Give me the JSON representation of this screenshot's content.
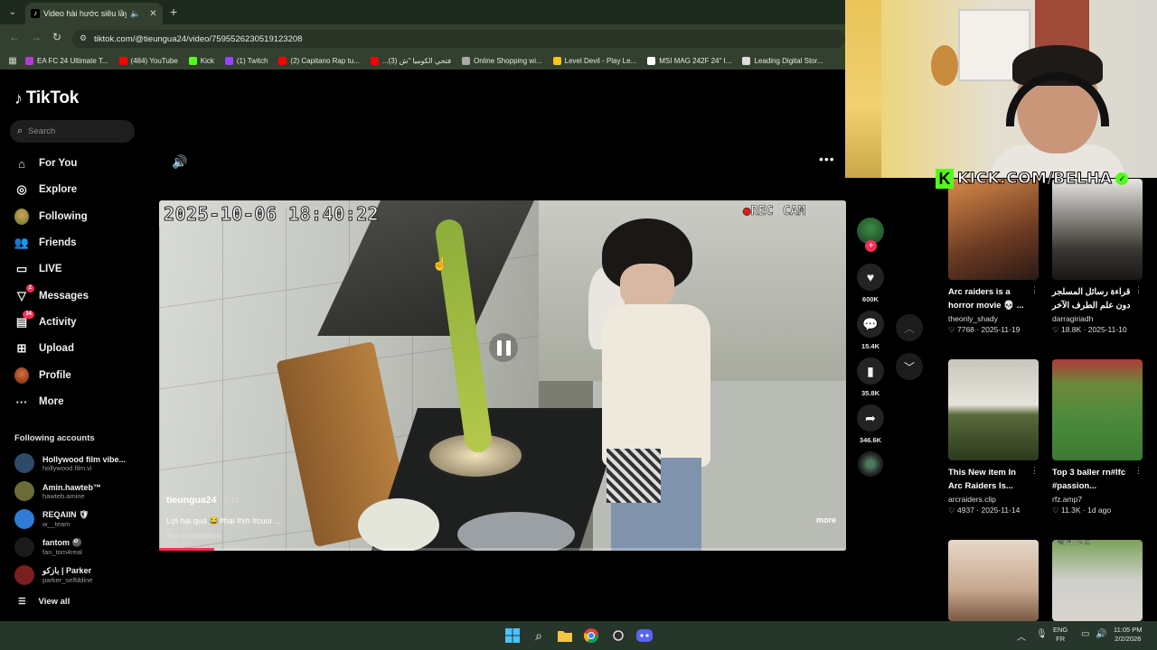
{
  "browser": {
    "tab_title": "Video hài hước siêu lầy lội",
    "url": "tiktok.com/@tieungua24/video/7595526230519123208",
    "bookmarks": [
      {
        "label": "EA FC 24 Ultimate T...",
        "color": "#b23bd6"
      },
      {
        "label": "(484) YouTube",
        "color": "#ff0000"
      },
      {
        "label": "Kick",
        "color": "#53fc18"
      },
      {
        "label": "(1) Twitch",
        "color": "#9146ff"
      },
      {
        "label": "(2) Capitano Rap tu...",
        "color": "#ff0000"
      },
      {
        "label": "...فتحي الكوميا \"ش (3)",
        "color": "#ff0000"
      },
      {
        "label": "Online Shopping wi...",
        "color": "#aaaaaa"
      },
      {
        "label": "Level Devil - Play Le...",
        "color": "#f5c518"
      },
      {
        "label": "MSI MAG 242F 24\" I...",
        "color": "#ffffff"
      },
      {
        "label": "Leading Digital Stor...",
        "color": "#dddddd"
      }
    ]
  },
  "sidebar": {
    "logo_text": "TikTok",
    "search_placeholder": "Search",
    "nav": [
      {
        "label": "For You",
        "icon": "home-icon",
        "glyph": "⌂"
      },
      {
        "label": "Explore",
        "icon": "compass-icon",
        "glyph": "◎"
      },
      {
        "label": "Following",
        "icon": "following-avatar-icon",
        "glyph": ""
      },
      {
        "label": "Friends",
        "icon": "friends-icon",
        "glyph": "👥"
      },
      {
        "label": "LIVE",
        "icon": "live-icon",
        "glyph": "▭"
      },
      {
        "label": "Messages",
        "icon": "send-icon",
        "glyph": "▽",
        "badge": "2"
      },
      {
        "label": "Activity",
        "icon": "inbox-icon",
        "glyph": "▤",
        "badge": "34"
      },
      {
        "label": "Upload",
        "icon": "upload-icon",
        "glyph": "⊞"
      },
      {
        "label": "Profile",
        "icon": "profile-avatar-icon",
        "glyph": ""
      },
      {
        "label": "More",
        "icon": "more-dots-icon",
        "glyph": "···"
      }
    ],
    "following_title": "Following accounts",
    "accounts": [
      {
        "name": "Hollywood film vibe...",
        "handle": "hollywood.film.vi",
        "color": "#2e4a6b"
      },
      {
        "name": "Amin.hawteb™",
        "handle": "hawteb.amine",
        "color": "#6b6b3a"
      },
      {
        "name": "REQAIIN 🛡",
        "handle": "w__team",
        "color": "#2f7bd6"
      },
      {
        "name": "fantom 🎱",
        "handle": "fan_tom4real",
        "color": "#1a1a1a"
      },
      {
        "name": "بازكو | Parker",
        "handle": "parker_selfddine",
        "color": "#7a1e1e"
      }
    ],
    "view_all": "View all"
  },
  "video": {
    "timestamp": "2025-10-06 18:40:22",
    "rec": "REC",
    "cam": "CAM",
    "author": "tieungua24",
    "post_time": "· 1-15",
    "caption": "Lợi hại quá 😂#hai #xh #cuoi ...",
    "translate": "See translation",
    "more": "more",
    "progress": 0.08
  },
  "actions": {
    "likes": "600K",
    "comments": "15.4K",
    "saves": "35.8K",
    "shares": "346.6K"
  },
  "overlay": {
    "kick_text": "KICK.COM/BELHA"
  },
  "related": [
    {
      "title": "Arc raiders is a horror movie 💀 ...",
      "user": "theonly_shady",
      "likes": "7768",
      "date": "2025-11-19",
      "bg": "linear-gradient(160deg,#d88a4a,#6b3a22 60%,#2a1a14)"
    },
    {
      "title": "قراءة رسائل المسلجر دون علم الطرف الآخر",
      "user": "darragiriadh",
      "likes": "18.8K",
      "date": "2025-11-10",
      "bg": "linear-gradient(180deg,#e8e6e2,#3a3632 70%,#1a1816)"
    },
    {
      "title": "This New item In Arc Raiders Is...",
      "user": "arcraiders.clip",
      "likes": "4937",
      "date": "2025-11-14",
      "bg": "linear-gradient(180deg,#c9c6bd 0%,#e7e3da 45%,#5a6a3a 55%,#2c3a1e)"
    },
    {
      "title": "Top 3 baller rn#lfc #passion...",
      "user": "rfz.amp7",
      "likes": "11.3K",
      "date": "1d ago",
      "bg": "linear-gradient(180deg,#b03a3a 0%,#6a8a3a 25%,#4b8a3c 60%,#3d7a32)"
    },
    {
      "title": "",
      "user": "",
      "likes": "",
      "date": "",
      "bg": "linear-gradient(180deg,#e6d8c8,#c8a98f 60%,#7a5a44)"
    },
    {
      "title": "",
      "user": "",
      "likes": "",
      "date": "",
      "bg": "linear-gradient(180deg,#7aa25a,#cfcfcb 50%,#d8d4cc)"
    }
  ],
  "related_overlay_text": "*#L'*D 7+ !!!",
  "taskbar": {
    "lang1": "ENG",
    "lang2": "FR",
    "time": "11:05 PM",
    "date": "2/2/2026"
  }
}
